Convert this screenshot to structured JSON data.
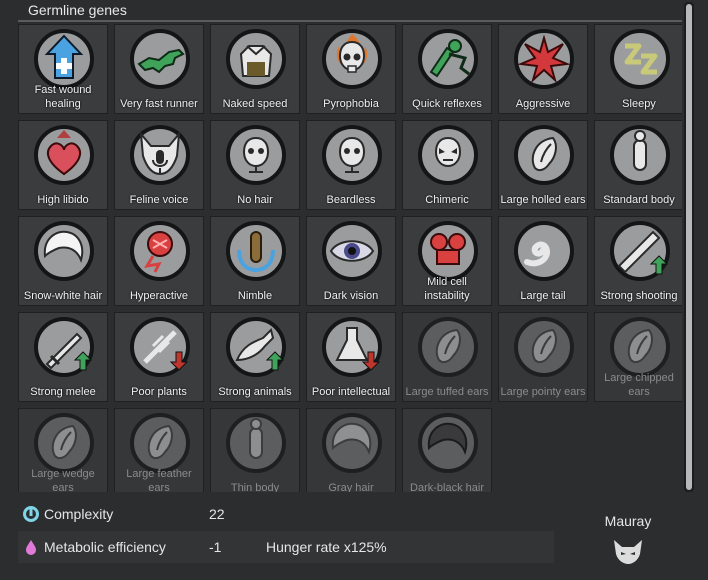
{
  "section_title": "Germline genes",
  "genes": [
    {
      "label": "Fast wound healing",
      "icon": "fast-wound-healing-icon",
      "active": true
    },
    {
      "label": "Very fast runner",
      "icon": "running-dog-icon",
      "active": true
    },
    {
      "label": "Naked speed",
      "icon": "naked-speed-icon",
      "active": true
    },
    {
      "label": "Pyrophobia",
      "icon": "flaming-skull-icon",
      "active": true
    },
    {
      "label": "Quick reflexes",
      "icon": "quick-reflexes-icon",
      "active": true
    },
    {
      "label": "Aggressive",
      "icon": "aggressive-burst-icon",
      "active": true
    },
    {
      "label": "Sleepy",
      "icon": "sleepy-zz-icon",
      "active": true
    },
    {
      "label": "High libido",
      "icon": "heart-up-icon",
      "active": true
    },
    {
      "label": "Feline voice",
      "icon": "feline-voice-icon",
      "active": true
    },
    {
      "label": "No hair",
      "icon": "no-hair-head-icon",
      "active": true
    },
    {
      "label": "Beardless",
      "icon": "beardless-head-icon",
      "active": true
    },
    {
      "label": "Chimeric",
      "icon": "chimeric-face-icon",
      "active": true
    },
    {
      "label": "Large holled ears",
      "icon": "holled-ear-icon",
      "active": true
    },
    {
      "label": "Standard body",
      "icon": "standard-body-icon",
      "active": true
    },
    {
      "label": "Snow-white hair",
      "icon": "white-hair-icon",
      "active": true
    },
    {
      "label": "Hyperactive",
      "icon": "hyperactive-icon",
      "active": true
    },
    {
      "label": "Nimble",
      "icon": "nimble-icon",
      "active": true
    },
    {
      "label": "Dark vision",
      "icon": "dark-vision-eye-icon",
      "active": true
    },
    {
      "label": "Mild cell instability",
      "icon": "cell-instability-icon",
      "active": true
    },
    {
      "label": "Large tail",
      "icon": "tail-icon",
      "active": true
    },
    {
      "label": "Strong shooting",
      "icon": "rifle-up-icon",
      "active": true
    },
    {
      "label": "Strong melee",
      "icon": "sword-up-icon",
      "active": true
    },
    {
      "label": "Poor plants",
      "icon": "plants-down-icon",
      "active": true
    },
    {
      "label": "Strong animals",
      "icon": "animals-up-icon",
      "active": true
    },
    {
      "label": "Poor intellectual",
      "icon": "flask-down-icon",
      "active": true
    },
    {
      "label": "Large tuffed ears",
      "icon": "tuffed-ear-icon",
      "active": false
    },
    {
      "label": "Large pointy ears",
      "icon": "pointy-ear-icon",
      "active": false
    },
    {
      "label": "Large chipped ears",
      "icon": "chipped-ear-icon",
      "active": false
    },
    {
      "label": "Large wedge ears",
      "icon": "wedge-ear-icon",
      "active": false
    },
    {
      "label": "Large feather ears",
      "icon": "feather-ear-icon",
      "active": false
    },
    {
      "label": "Thin body",
      "icon": "thin-body-icon",
      "active": false
    },
    {
      "label": "Gray hair",
      "icon": "gray-hair-icon",
      "active": false
    },
    {
      "label": "Dark-black hair",
      "icon": "black-hair-icon",
      "active": false
    }
  ],
  "stats": {
    "complexity": {
      "label": "Complexity",
      "value": "22",
      "icon": "complexity-icon"
    },
    "metabolic": {
      "label": "Metabolic efficiency",
      "value": "-1",
      "extra": "Hunger rate x125%",
      "icon": "metabolic-drop-icon"
    }
  },
  "xenotype": {
    "name": "Mauray",
    "icon": "cat-head-icon"
  },
  "colors": {
    "complexity": "#7fd4e6",
    "metabolic": "#e07ad8",
    "arrow_up": "#3fa35a",
    "arrow_down": "#c0362f",
    "icon_blue": "#4aa3e0"
  }
}
